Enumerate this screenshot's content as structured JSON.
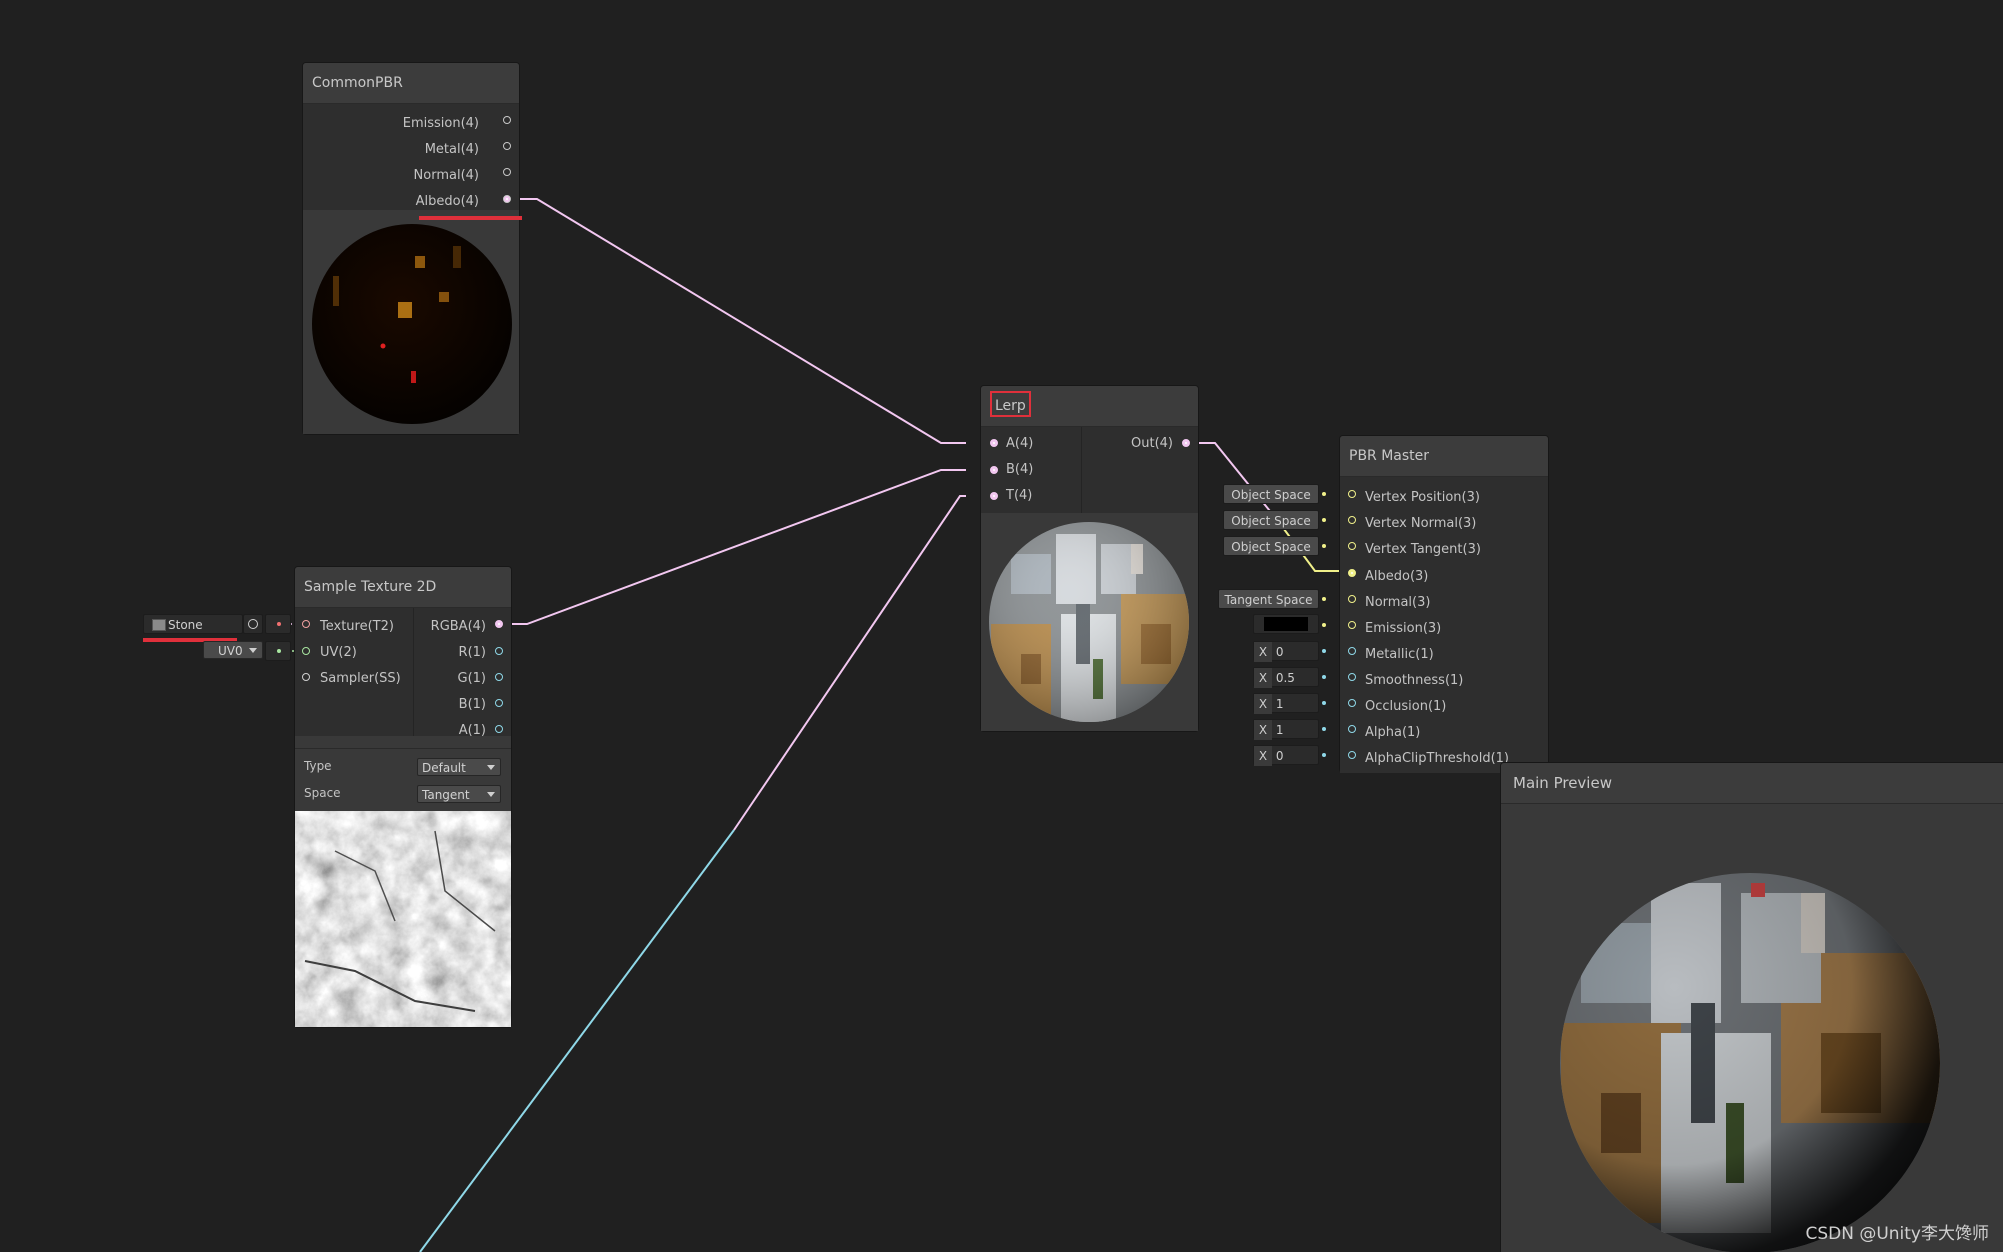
{
  "colors": {
    "background": "#202020",
    "wire_vector4": "#f2c7f0",
    "wire_vector1": "#8fd8e8",
    "wire_vector3": "#f0f08a",
    "highlight": "#e0303b"
  },
  "common_pbr": {
    "title": "CommonPBR",
    "outputs": [
      "Emission(4)",
      "Metal(4)",
      "Normal(4)",
      "Albedo(4)"
    ]
  },
  "sample_texture": {
    "title": "Sample Texture 2D",
    "inputs": [
      "Texture(T2)",
      "UV(2)",
      "Sampler(SS)"
    ],
    "outputs": [
      "RGBA(4)",
      "R(1)",
      "G(1)",
      "B(1)",
      "A(1)"
    ],
    "type_label": "Type",
    "type_value": "Default",
    "space_label": "Space",
    "space_value": "Tangent",
    "texture_field": "Stone",
    "uv_field": "UV0"
  },
  "lerp": {
    "title": "Lerp",
    "inputs": [
      "A(4)",
      "B(4)",
      "T(4)"
    ],
    "output": "Out(4)"
  },
  "pbr_master": {
    "title": "PBR Master",
    "inputs": [
      "Vertex Position(3)",
      "Vertex Normal(3)",
      "Vertex Tangent(3)",
      "Albedo(3)",
      "Normal(3)",
      "Emission(3)",
      "Metallic(1)",
      "Smoothness(1)",
      "Occlusion(1)",
      "Alpha(1)",
      "AlphaClipThreshold(1)"
    ],
    "space_fields": [
      "Object Space",
      "Object Space",
      "Object Space",
      "Tangent Space"
    ],
    "x_label": "X",
    "metallic": "0",
    "smoothness": "0.5",
    "occlusion": "1",
    "alpha": "1",
    "alpha_clip": "0"
  },
  "main_preview": {
    "title": "Main Preview"
  },
  "watermark": "CSDN @Unity李大馋师"
}
